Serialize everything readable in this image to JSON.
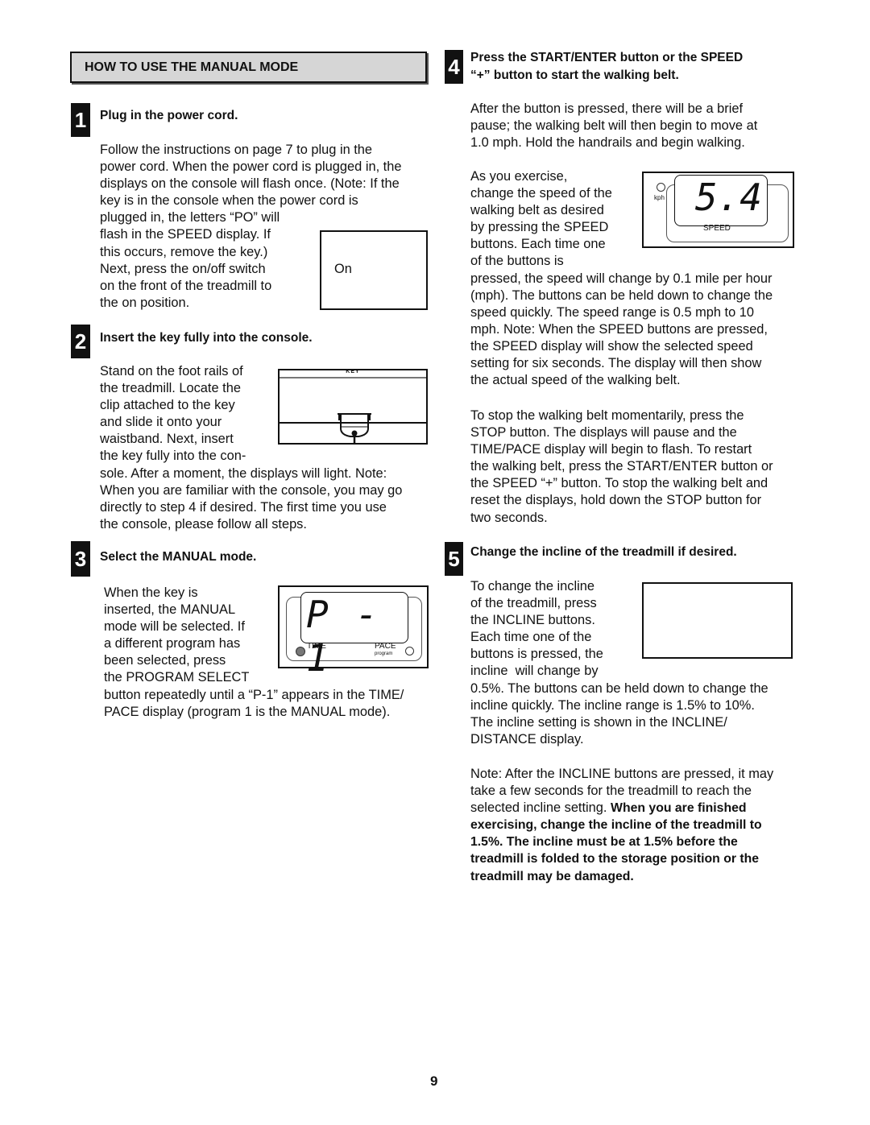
{
  "section_header": "HOW TO USE THE MANUAL MODE",
  "steps": [
    {
      "number": "1",
      "title": "Plug in the power cord.",
      "text": "Follow the instructions on page 7 to plug in the\npower cord. When the power cord is plugged in, the\ndisplays on the console will flash once. (Note: If the\nkey is in the console when the power cord is\nplugged in, the letters “PO” will\nflash in the SPEED display. If\nthis occurs, remove the key.)\nNext, press the on/off switch\non the front of the treadmill to\nthe on position.",
      "figure_label": "On"
    },
    {
      "number": "2",
      "title": "Insert the key fully into the console.",
      "text": "Stand on the foot rails of\nthe treadmill. Locate the\nclip attached to the key\nand slide it onto your\nwaistband. Next, insert\nthe key fully into the con-\nsole. After a moment, the displays will light. Note:\nWhen you are familiar with the console, you may go\ndirectly to step 4 if desired. The first time you use\nthe console, please follow all steps.",
      "figure_label": "KEY"
    },
    {
      "number": "3",
      "title": "Select the MANUAL mode.",
      "text": "When the key is\ninserted, the MANUAL\nmode will be selected. If\na different program has\nbeen selected, press\nthe PROGRAM SELECT\nbutton repeatedly until a “P-1” appears in the TIME/\nPACE display (program 1 is the MANUAL mode).",
      "display": {
        "readout": "P - 1",
        "left_label": "TIME",
        "right_label": "PACE",
        "right_sublabel": "program"
      }
    },
    {
      "number": "4",
      "title": "Press the START/ENTER button or the SPEED\n“+” button to start the walking belt.",
      "text1": "After the button is pressed, there will be a brief\npause; the walking belt will then begin to move at\n1.0 mph. Hold the handrails and begin walking.",
      "text2": "As you exercise,\nchange the speed of the\nwalking belt as desired\nby pressing the SPEED\nbuttons. Each time one\nof the buttons is\npressed, the speed will change by 0.1 mile per hour\n(mph). The buttons can be held down to change the\nspeed quickly. The speed range is 0.5 mph to 10\nmph. Note: When the SPEED buttons are pressed,\nthe SPEED display will show the selected speed\nsetting for six seconds. The display will then show\nthe actual speed of the walking belt.",
      "text3": "To stop the walking belt momentarily, press the\nSTOP button. The displays will pause and the\nTIME/PACE display will begin to flash. To restart\nthe walking belt, press the START/ENTER button or\nthe SPEED “+” button. To stop the walking belt and\nreset the displays, hold down the STOP button for\ntwo seconds.",
      "display": {
        "readout": "5.4",
        "unit": "kph",
        "label": "SPEED"
      }
    },
    {
      "number": "5",
      "title": "Change the incline of the treadmill if desired.",
      "text1": "To change the incline\nof the treadmill, press\nthe INCLINE buttons.\nEach time one of the\nbuttons is pressed, the\nincline  will change by\n0.5%. The buttons can be held down to change the\nincline quickly. The incline range is 1.5% to 10%.\nThe incline setting is shown in the INCLINE/\nDISTANCE display.",
      "note_plain": "Note: After the INCLINE buttons are pressed, it may\ntake a few seconds for the treadmill to reach the\nselected incline setting. ",
      "note_bold": "When you are finished\nexercising, change the incline of the treadmill to\n1.5%. The incline must be at 1.5% before the\ntreadmill is folded to the storage position or the\ntreadmill may be damaged."
    }
  ],
  "page_number": "9"
}
